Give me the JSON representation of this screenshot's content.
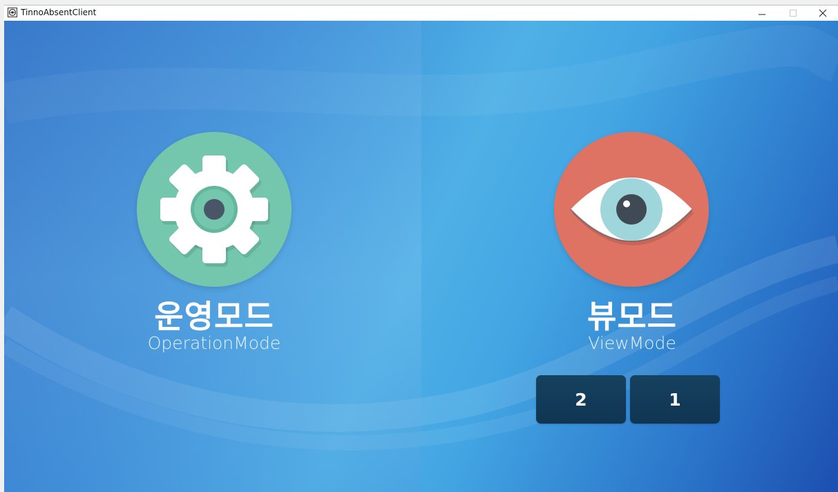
{
  "window": {
    "title": "TinnoAbsentClient",
    "controls": {
      "minimize": "–",
      "maximize": "□",
      "close": "✕"
    }
  },
  "operation_mode": {
    "title": "운영모드",
    "subtitle": "OperationMode",
    "icon": "gear-icon",
    "circle_color": "#74c7ad"
  },
  "view_mode": {
    "title": "뷰모드",
    "subtitle": "ViewMode",
    "icon": "eye-icon",
    "circle_color": "#de7263",
    "buttons": [
      "2",
      "1"
    ]
  }
}
